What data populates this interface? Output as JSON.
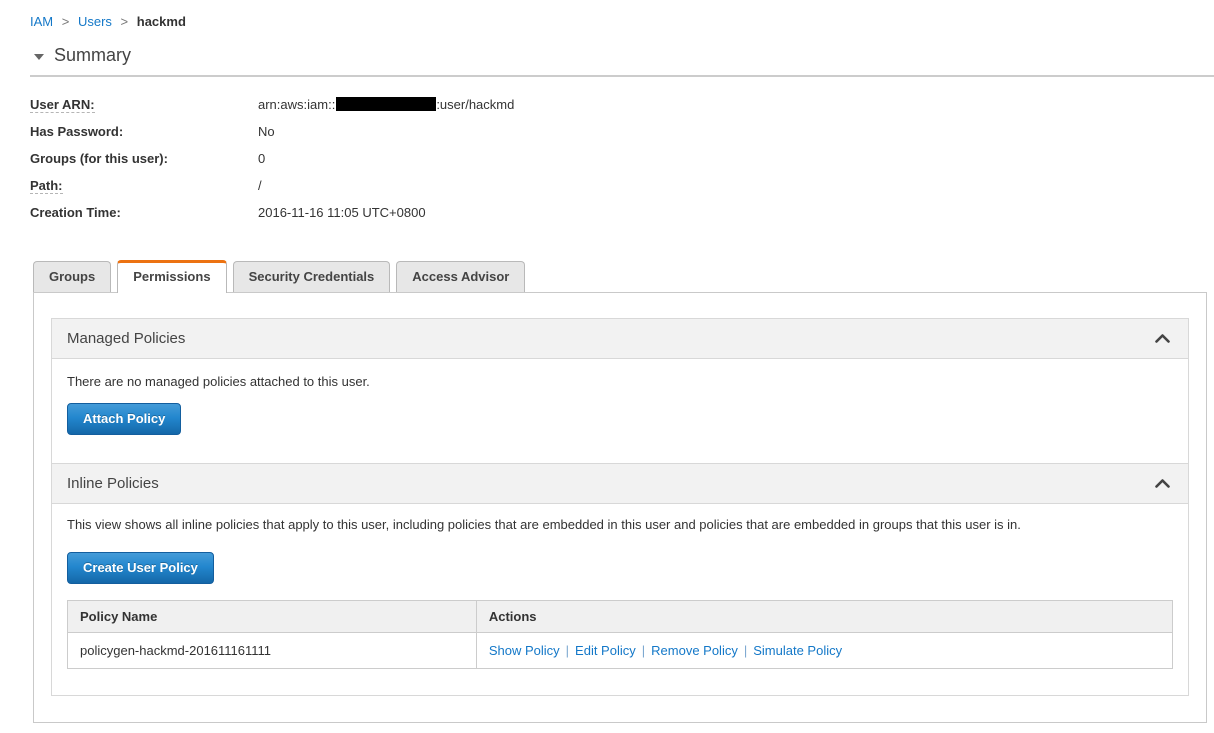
{
  "breadcrumb": {
    "separator": ">",
    "items": [
      {
        "label": "IAM"
      },
      {
        "label": "Users"
      },
      {
        "label": "hackmd"
      }
    ]
  },
  "summary": {
    "title": "Summary",
    "fields": {
      "user_arn": {
        "label": "User ARN:",
        "prefix": "arn:aws:iam::",
        "suffix": ":user/hackmd",
        "redacted_segment": "account-id-hidden"
      },
      "has_password": {
        "label": "Has Password:",
        "value": "No"
      },
      "groups": {
        "label": "Groups (for this user):",
        "value": "0"
      },
      "path": {
        "label": "Path:",
        "value": "/"
      },
      "creation_time": {
        "label": "Creation Time:",
        "value": "2016-11-16 11:05 UTC+0800"
      }
    }
  },
  "tabs": [
    {
      "label": "Groups",
      "active": false
    },
    {
      "label": "Permissions",
      "active": true
    },
    {
      "label": "Security Credentials",
      "active": false
    },
    {
      "label": "Access Advisor",
      "active": false
    }
  ],
  "managed_policies": {
    "title": "Managed Policies",
    "empty_message": "There are no managed policies attached to this user.",
    "attach_button_label": "Attach Policy",
    "collapse_icon": "chevron-up"
  },
  "inline_policies": {
    "title": "Inline Policies",
    "description": "This view shows all inline policies that apply to this user, including policies that are embedded in this user and policies that are embedded in groups that this user is in.",
    "create_button_label": "Create User Policy",
    "collapse_icon": "chevron-up",
    "table": {
      "headers": [
        "Policy Name",
        "Actions"
      ],
      "rows": [
        {
          "policy_name": "policygen-hackmd-201611161111",
          "actions": [
            "Show Policy",
            "Edit Policy",
            "Remove Policy",
            "Simulate Policy"
          ]
        }
      ]
    }
  },
  "colors": {
    "link_blue": "#1478c8",
    "active_tab_accent": "#ec7211",
    "button_gradient_top": "#449bd8",
    "button_gradient_bottom": "#1467a8",
    "section_header_bg": "#f2f2f2"
  }
}
